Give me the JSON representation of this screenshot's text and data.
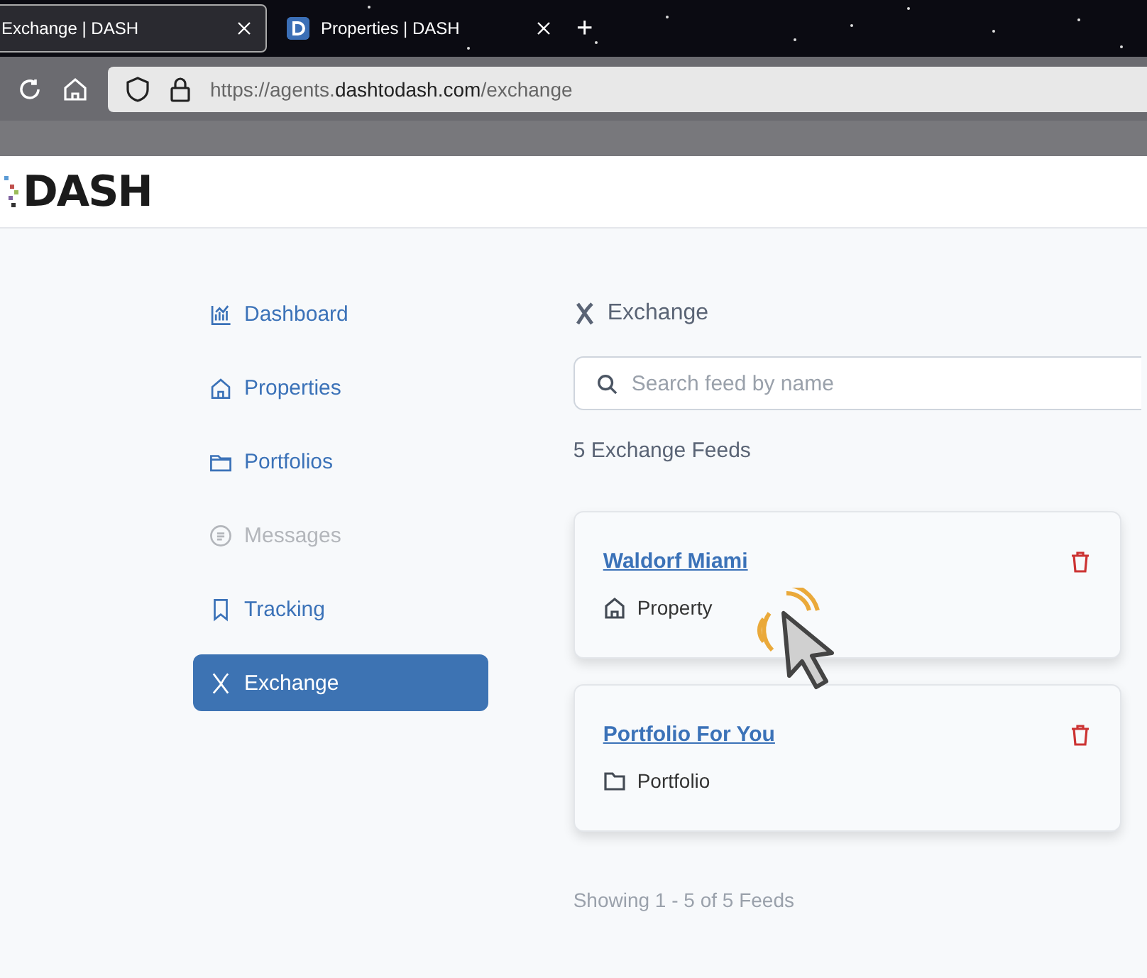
{
  "browser": {
    "tabs": [
      {
        "title": "Exchange | DASH",
        "selected": true
      },
      {
        "title": "Properties | DASH",
        "selected": false
      }
    ],
    "new_tab": "+",
    "address": {
      "prefix": "https://agents.",
      "domain": "dashtodash.com",
      "path": "/exchange"
    }
  },
  "header": {
    "logo": "DASH"
  },
  "sidebar": {
    "items": [
      {
        "label": "Dashboard",
        "selected": false,
        "disabled": false
      },
      {
        "label": "Properties",
        "selected": false,
        "disabled": false
      },
      {
        "label": "Portfolios",
        "selected": false,
        "disabled": false
      },
      {
        "label": "Messages",
        "selected": false,
        "disabled": true
      },
      {
        "label": "Tracking",
        "selected": false,
        "disabled": false
      },
      {
        "label": "Exchange",
        "selected": true,
        "disabled": false
      }
    ]
  },
  "main": {
    "title": "Exchange",
    "search": {
      "placeholder": "Search feed by name"
    },
    "count": "5 Exchange Feeds",
    "feeds": [
      {
        "name": "Waldorf Miami",
        "type": "Property",
        "kind": "property"
      },
      {
        "name": "Portfolio For You",
        "type": "Portfolio",
        "kind": "portfolio"
      }
    ],
    "footer": "Showing 1 - 5 of 5 Feeds"
  }
}
